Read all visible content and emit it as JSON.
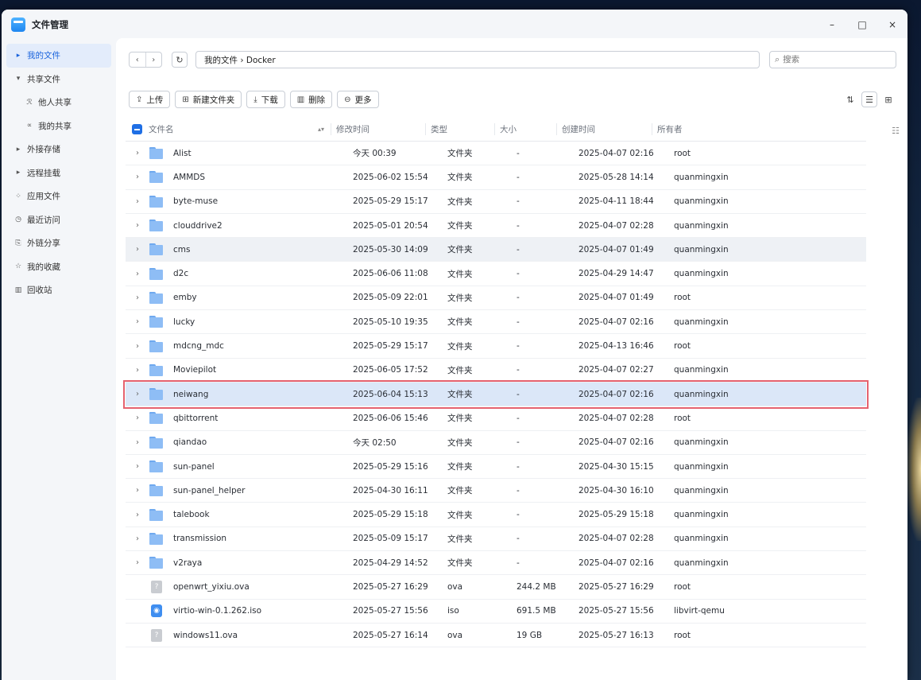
{
  "app": {
    "title": "文件管理"
  },
  "window_controls": {
    "minimize": "–",
    "maximize": "□",
    "close": "×"
  },
  "sidebar": {
    "items": [
      {
        "label": "我的文件",
        "icon": "▸",
        "icon_name": "caret-right-icon",
        "active": true
      },
      {
        "label": "共享文件",
        "icon": "▾",
        "icon_name": "caret-down-icon"
      },
      {
        "label": "他人共享",
        "icon": "ℛ",
        "icon_name": "users-icon",
        "sub": true
      },
      {
        "label": "我的共享",
        "icon": "∝",
        "icon_name": "share-icon",
        "sub": true
      },
      {
        "label": "外接存储",
        "icon": "▸",
        "icon_name": "caret-right-icon"
      },
      {
        "label": "远程挂载",
        "icon": "▸",
        "icon_name": "caret-right-icon"
      },
      {
        "label": "应用文件",
        "icon": "⁘",
        "icon_name": "apps-icon"
      },
      {
        "label": "最近访问",
        "icon": "◷",
        "icon_name": "clock-icon"
      },
      {
        "label": "外链分享",
        "icon": "⎘",
        "icon_name": "external-link-icon"
      },
      {
        "label": "我的收藏",
        "icon": "☆",
        "icon_name": "star-icon"
      },
      {
        "label": "回收站",
        "icon": "▥",
        "icon_name": "trash-icon"
      }
    ]
  },
  "pathbar": {
    "back": "‹",
    "forward": "›",
    "refresh": "↻",
    "path": "我的文件 › Docker",
    "search_placeholder": "搜索"
  },
  "toolbar": {
    "upload": "上传",
    "new_folder": "新建文件夹",
    "download": "下载",
    "delete": "删除",
    "more": "更多"
  },
  "table": {
    "headers": {
      "name": "文件名",
      "modified": "修改时间",
      "type": "类型",
      "size": "大小",
      "created": "创建时间",
      "owner": "所有者"
    },
    "rows": [
      {
        "name": "Alist",
        "modified": "今天 00:39",
        "type": "文件夹",
        "size": "-",
        "created": "2025-04-07 02:16",
        "owner": "root",
        "kind": "folder"
      },
      {
        "name": "AMMDS",
        "modified": "2025-06-02 15:54",
        "type": "文件夹",
        "size": "-",
        "created": "2025-05-28 14:14",
        "owner": "quanmingxin",
        "kind": "folder"
      },
      {
        "name": "byte-muse",
        "modified": "2025-05-29 15:17",
        "type": "文件夹",
        "size": "-",
        "created": "2025-04-11 18:44",
        "owner": "quanmingxin",
        "kind": "folder"
      },
      {
        "name": "clouddrive2",
        "modified": "2025-05-01 20:54",
        "type": "文件夹",
        "size": "-",
        "created": "2025-04-07 02:28",
        "owner": "quanmingxin",
        "kind": "folder"
      },
      {
        "name": "cms",
        "modified": "2025-05-30 14:09",
        "type": "文件夹",
        "size": "-",
        "created": "2025-04-07 01:49",
        "owner": "quanmingxin",
        "kind": "folder",
        "hover": true
      },
      {
        "name": "d2c",
        "modified": "2025-06-06 11:08",
        "type": "文件夹",
        "size": "-",
        "created": "2025-04-29 14:47",
        "owner": "quanmingxin",
        "kind": "folder"
      },
      {
        "name": "emby",
        "modified": "2025-05-09 22:01",
        "type": "文件夹",
        "size": "-",
        "created": "2025-04-07 01:49",
        "owner": "root",
        "kind": "folder"
      },
      {
        "name": "lucky",
        "modified": "2025-05-10 19:35",
        "type": "文件夹",
        "size": "-",
        "created": "2025-04-07 02:16",
        "owner": "quanmingxin",
        "kind": "folder"
      },
      {
        "name": "mdcng_mdc",
        "modified": "2025-05-29 15:17",
        "type": "文件夹",
        "size": "-",
        "created": "2025-04-13 16:46",
        "owner": "root",
        "kind": "folder"
      },
      {
        "name": "Moviepilot",
        "modified": "2025-06-05 17:52",
        "type": "文件夹",
        "size": "-",
        "created": "2025-04-07 02:27",
        "owner": "quanmingxin",
        "kind": "folder"
      },
      {
        "name": "neiwang",
        "modified": "2025-06-04 15:13",
        "type": "文件夹",
        "size": "-",
        "created": "2025-04-07 02:16",
        "owner": "quanmingxin",
        "kind": "folder",
        "selected": true
      },
      {
        "name": "qbittorrent",
        "modified": "2025-06-06 15:46",
        "type": "文件夹",
        "size": "-",
        "created": "2025-04-07 02:28",
        "owner": "root",
        "kind": "folder"
      },
      {
        "name": "qiandao",
        "modified": "今天 02:50",
        "type": "文件夹",
        "size": "-",
        "created": "2025-04-07 02:16",
        "owner": "quanmingxin",
        "kind": "folder"
      },
      {
        "name": "sun-panel",
        "modified": "2025-05-29 15:16",
        "type": "文件夹",
        "size": "-",
        "created": "2025-04-30 15:15",
        "owner": "quanmingxin",
        "kind": "folder"
      },
      {
        "name": "sun-panel_helper",
        "modified": "2025-04-30 16:11",
        "type": "文件夹",
        "size": "-",
        "created": "2025-04-30 16:10",
        "owner": "quanmingxin",
        "kind": "folder"
      },
      {
        "name": "talebook",
        "modified": "2025-05-29 15:18",
        "type": "文件夹",
        "size": "-",
        "created": "2025-05-29 15:18",
        "owner": "quanmingxin",
        "kind": "folder"
      },
      {
        "name": "transmission",
        "modified": "2025-05-09 15:17",
        "type": "文件夹",
        "size": "-",
        "created": "2025-04-07 02:28",
        "owner": "quanmingxin",
        "kind": "folder"
      },
      {
        "name": "v2raya",
        "modified": "2025-04-29 14:52",
        "type": "文件夹",
        "size": "-",
        "created": "2025-04-07 02:16",
        "owner": "quanmingxin",
        "kind": "folder"
      },
      {
        "name": "openwrt_yixiu.ova",
        "modified": "2025-05-27 16:29",
        "type": "ova",
        "size": "244.2 MB",
        "created": "2025-05-27 16:29",
        "owner": "root",
        "kind": "file",
        "glyph": "?"
      },
      {
        "name": "virtio-win-0.1.262.iso",
        "modified": "2025-05-27 15:56",
        "type": "iso",
        "size": "691.5 MB",
        "created": "2025-05-27 15:56",
        "owner": "libvirt-qemu",
        "kind": "iso",
        "glyph": "◉"
      },
      {
        "name": "windows11.ova",
        "modified": "2025-05-27 16:14",
        "type": "ova",
        "size": "19 GB",
        "created": "2025-05-27 16:13",
        "owner": "root",
        "kind": "file",
        "glyph": "?"
      }
    ]
  },
  "colors": {
    "accent": "#1a63dc",
    "selected_outline": "#e5626f",
    "selected_bg": "#dbe7f8",
    "folder": "#8ebdf5"
  }
}
